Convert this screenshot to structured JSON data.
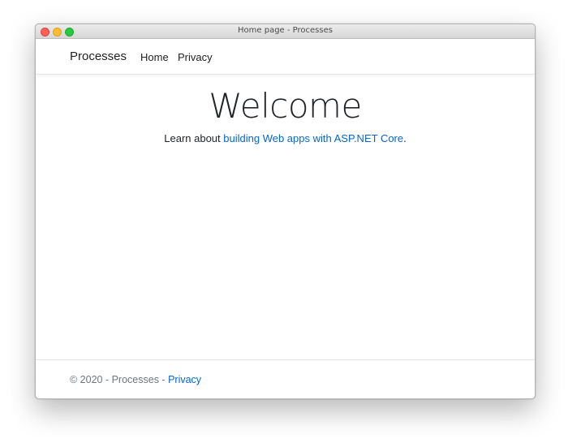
{
  "window": {
    "title": "Home page - Processes"
  },
  "navbar": {
    "brand": "Processes",
    "links": [
      "Home",
      "Privacy"
    ]
  },
  "main": {
    "heading": "Welcome",
    "intro_prefix": "Learn about ",
    "intro_link": "building Web apps with ASP.NET Core",
    "intro_suffix": "."
  },
  "footer": {
    "copyright": "© 2020 - Processes - ",
    "privacy_link": "Privacy"
  },
  "colors": {
    "link": "#0366d6",
    "text": "#212529",
    "muted": "#6c757d"
  }
}
